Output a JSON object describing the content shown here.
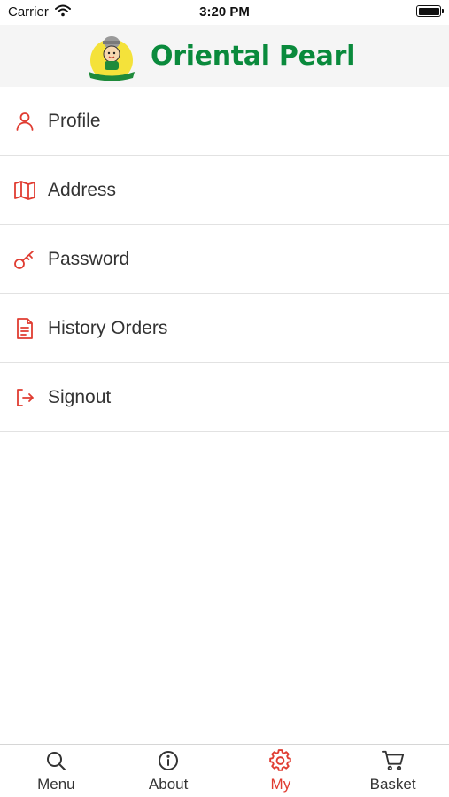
{
  "status_bar": {
    "carrier": "Carrier",
    "time": "3:20 PM"
  },
  "header": {
    "brand": "Oriental Pearl",
    "logo_banner_text": "Oriental Pearl"
  },
  "menu": [
    {
      "label": "Profile",
      "icon": "user-icon"
    },
    {
      "label": "Address",
      "icon": "map-icon"
    },
    {
      "label": "Password",
      "icon": "key-icon"
    },
    {
      "label": "History Orders",
      "icon": "document-icon"
    },
    {
      "label": "Signout",
      "icon": "signout-icon"
    }
  ],
  "tabs": [
    {
      "label": "Menu",
      "icon": "search-icon",
      "active": false
    },
    {
      "label": "About",
      "icon": "info-icon",
      "active": false
    },
    {
      "label": "My",
      "icon": "gear-icon",
      "active": true
    },
    {
      "label": "Basket",
      "icon": "cart-icon",
      "active": false
    }
  ],
  "colors": {
    "accent": "#e03c31",
    "brand_green": "#0a8a3c",
    "header_bg": "#f5f5f5",
    "icon_gray": "#333333"
  }
}
